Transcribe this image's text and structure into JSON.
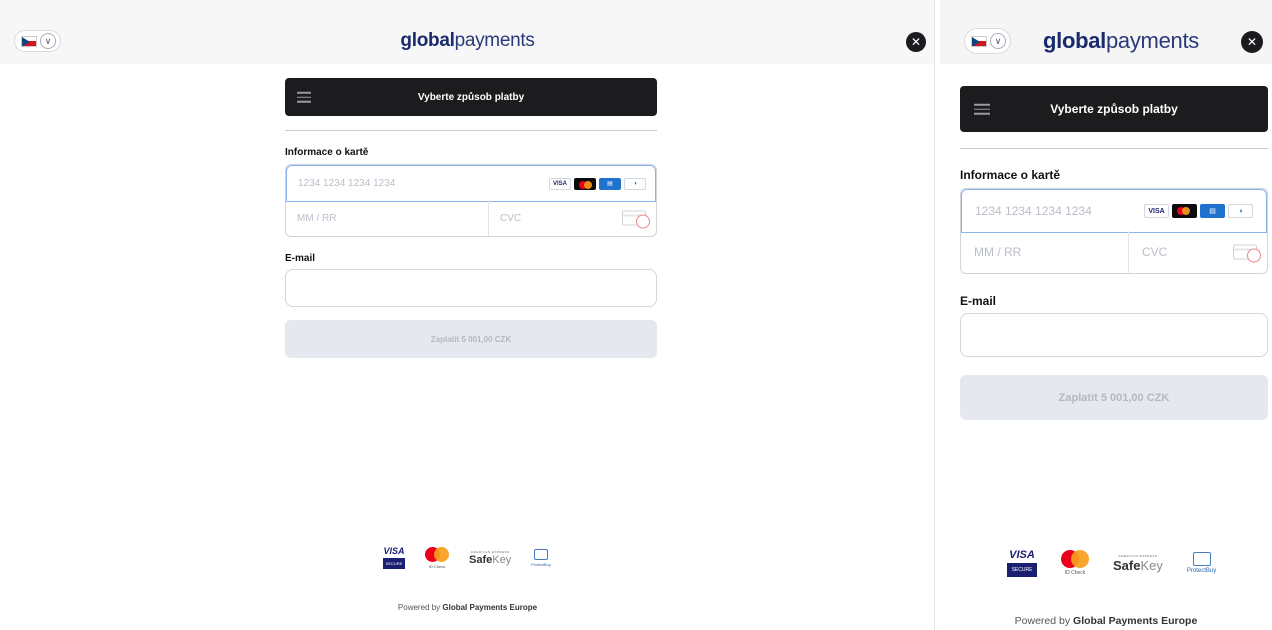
{
  "logo": {
    "bold": "global",
    "light": "payments"
  },
  "language": {
    "flag": "czech-flag",
    "chevron": "chevron-down-icon"
  },
  "close_glyph": "✕",
  "methods_button": "Vyberte způsob platby",
  "card_section": {
    "label": "Informace o kartě",
    "number_placeholder": "1234 1234 1234 1234",
    "expiry_placeholder": "MM / RR",
    "cvc_placeholder": "CVC",
    "brands": [
      "VISA",
      "mastercard",
      "amex",
      "diners"
    ]
  },
  "email": {
    "label": "E-mail",
    "value": ""
  },
  "pay_button": "Zaplatit 5 001,00 CZK",
  "footer": {
    "visa_secure_top": "VISA",
    "visa_secure_bottom": "SECURE",
    "mc_caption": "ID Check",
    "safekey_top": "AMERICAN EXPRESS",
    "safekey_bold": "Safe",
    "safekey_light": "Key",
    "protectbuy": "ProtectBuy",
    "powered_prefix": "Powered by ",
    "powered_brand": "Global Payments Europe"
  }
}
